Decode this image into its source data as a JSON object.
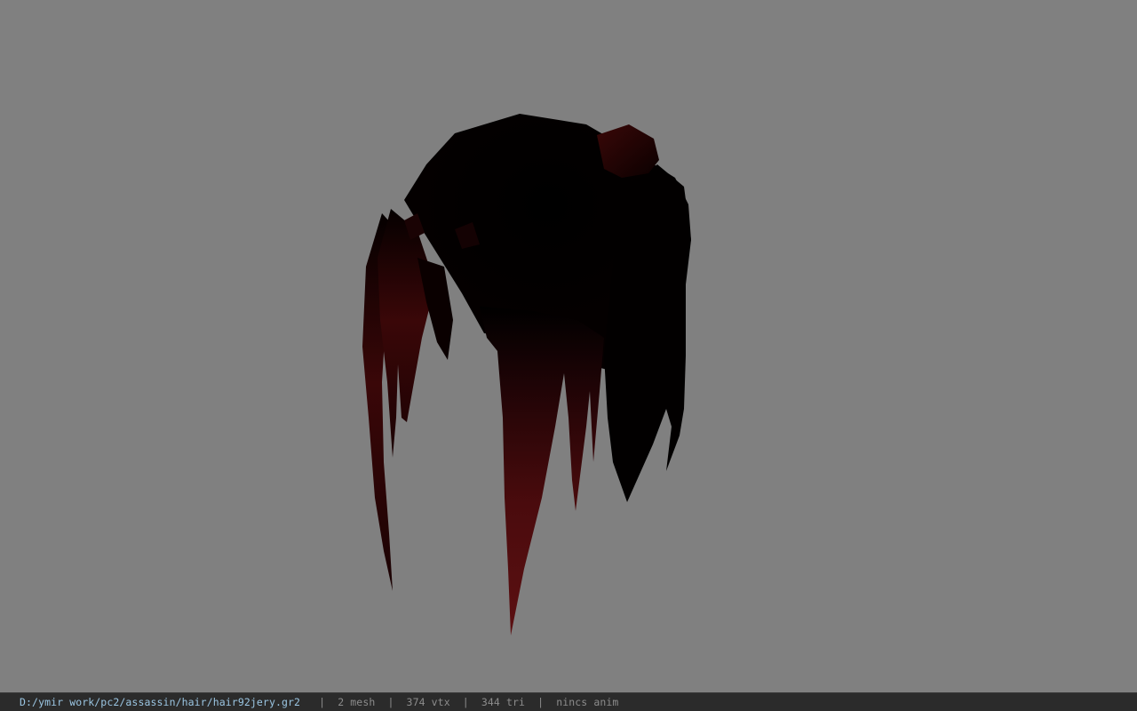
{
  "viewport": {
    "background_color": "#808080",
    "model": {
      "description_icon": "hair-mesh-model",
      "base_color": "#000000",
      "tint_color": "#5a0e10"
    }
  },
  "statusbar": {
    "file_path": "D:/ymir work/pc2/assassin/hair/hair92jery.gr2",
    "separator": "|",
    "mesh_count": "2 mesh",
    "vertex_count": "374 vtx",
    "triangle_count": "344 tri",
    "anim_status": "nincs anim",
    "path_color": "#9bc6e3",
    "text_color": "#8c8c8c"
  }
}
